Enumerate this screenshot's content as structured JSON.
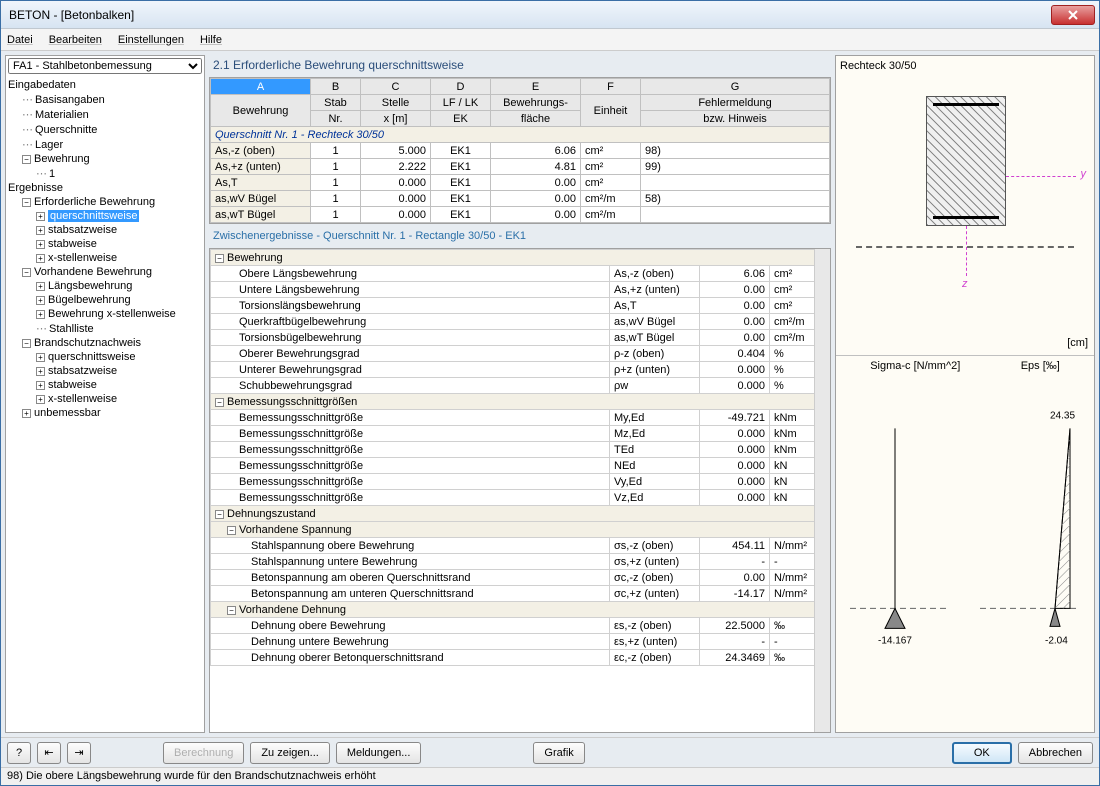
{
  "window": {
    "title": "BETON - [Betonbalken]"
  },
  "menu": {
    "datei": "Datei",
    "bearbeiten": "Bearbeiten",
    "einstellungen": "Einstellungen",
    "hilfe": "Hilfe"
  },
  "sidebar": {
    "selector": "FA1 - Stahlbetonbemessung",
    "nodes": {
      "eingabedaten": "Eingabedaten",
      "basisangaben": "Basisangaben",
      "materialien": "Materialien",
      "querschnitte": "Querschnitte",
      "lager": "Lager",
      "bewehrung": "Bewehrung",
      "bewehrung_1": "1",
      "ergebnisse": "Ergebnisse",
      "erforderliche": "Erforderliche Bewehrung",
      "querschnittsweise": "querschnittsweise",
      "stabsatzweise": "stabsatzweise",
      "stabweise": "stabweise",
      "xstellenweise": "x-stellenweise",
      "vorhandene": "Vorhandene Bewehrung",
      "langsbewehrung": "Längsbewehrung",
      "bugelbewehrung": "Bügelbewehrung",
      "bewehrung_x": "Bewehrung x-stellenweise",
      "stahlliste": "Stahlliste",
      "brandschutz": "Brandschutznachweis",
      "bs_querschnittsweise": "querschnittsweise",
      "bs_stabsatzweise": "stabsatzweise",
      "bs_stabweise": "stabweise",
      "bs_xstellenweise": "x-stellenweise",
      "unbemessbar": "unbemessbar"
    }
  },
  "main": {
    "title": "2.1 Erforderliche Bewehrung querschnittsweise",
    "cols": {
      "A": "A",
      "B": "B",
      "C": "C",
      "D": "D",
      "E": "E",
      "F": "F",
      "G": "G"
    },
    "headers": {
      "bewehrung": "Bewehrung",
      "stab_nr": "Stab\nNr.",
      "stelle": "Stelle\nx [m]",
      "lflk": "LF / LK\nEK",
      "bflache": "Bewehrungs-\nfläche",
      "einheit": "Einheit",
      "fehler": "Fehlermeldung\nbzw. Hinweis"
    },
    "section_row": "Querschnitt Nr. 1 - Rechteck 30/50",
    "rows": [
      {
        "label": "As,-z (oben)",
        "nr": "1",
        "x": "5.000",
        "ek": "EK1",
        "area": "6.06",
        "unit": "cm²",
        "note": "98)"
      },
      {
        "label": "As,+z (unten)",
        "nr": "1",
        "x": "2.222",
        "ek": "EK1",
        "area": "4.81",
        "unit": "cm²",
        "note": "99)"
      },
      {
        "label": "As,T",
        "nr": "1",
        "x": "0.000",
        "ek": "EK1",
        "area": "0.00",
        "unit": "cm²",
        "note": ""
      },
      {
        "label": "as,wV Bügel",
        "nr": "1",
        "x": "0.000",
        "ek": "EK1",
        "area": "0.00",
        "unit": "cm²/m",
        "note": "58)"
      },
      {
        "label": "as,wT Bügel",
        "nr": "1",
        "x": "0.000",
        "ek": "EK1",
        "area": "0.00",
        "unit": "cm²/m",
        "note": ""
      }
    ],
    "sub_title": "Zwischenergebnisse  -  Querschnitt Nr. 1 - Rectangle 30/50  -  EK1",
    "details": {
      "g_bewehrung": "Bewehrung",
      "obere_langs": {
        "label": "Obere Längsbewehrung",
        "sym": "As,-z (oben)",
        "val": "6.06",
        "unit": "cm²"
      },
      "untere_langs": {
        "label": "Untere Längsbewehrung",
        "sym": "As,+z (unten)",
        "val": "0.00",
        "unit": "cm²"
      },
      "torsions_langs": {
        "label": "Torsionslängsbewehrung",
        "sym": "As,T",
        "val": "0.00",
        "unit": "cm²"
      },
      "querkraft": {
        "label": "Querkraftbügelbewehrung",
        "sym": "as,wV Bügel",
        "val": "0.00",
        "unit": "cm²/m"
      },
      "torsions_bugel": {
        "label": "Torsionsbügelbewehrung",
        "sym": "as,wT Bügel",
        "val": "0.00",
        "unit": "cm²/m"
      },
      "oberer_grad": {
        "label": "Oberer Bewehrungsgrad",
        "sym": "ρ-z (oben)",
        "val": "0.404",
        "unit": "%"
      },
      "unterer_grad": {
        "label": "Unterer Bewehrungsgrad",
        "sym": "ρ+z (unten)",
        "val": "0.000",
        "unit": "%"
      },
      "schub_grad": {
        "label": "Schubbewehrungsgrad",
        "sym": "ρw",
        "val": "0.000",
        "unit": "%"
      },
      "g_bemessung": "Bemessungsschnittgrößen",
      "myed": {
        "label": "Bemessungsschnittgröße",
        "sym": "My,Ed",
        "val": "-49.721",
        "unit": "kNm"
      },
      "mzed": {
        "label": "Bemessungsschnittgröße",
        "sym": "Mz,Ed",
        "val": "0.000",
        "unit": "kNm"
      },
      "ted": {
        "label": "Bemessungsschnittgröße",
        "sym": "TEd",
        "val": "0.000",
        "unit": "kNm"
      },
      "ned": {
        "label": "Bemessungsschnittgröße",
        "sym": "NEd",
        "val": "0.000",
        "unit": "kN"
      },
      "vyed": {
        "label": "Bemessungsschnittgröße",
        "sym": "Vy,Ed",
        "val": "0.000",
        "unit": "kN"
      },
      "vzed": {
        "label": "Bemessungsschnittgröße",
        "sym": "Vz,Ed",
        "val": "0.000",
        "unit": "kN"
      },
      "g_dehnung": "Dehnungszustand",
      "g_spannung": "Vorhandene Spannung",
      "sigma_so": {
        "label": "Stahlspannung obere Bewehrung",
        "sym": "σs,-z (oben)",
        "val": "454.11",
        "unit": "N/mm²"
      },
      "sigma_su": {
        "label": "Stahlspannung untere Bewehrung",
        "sym": "σs,+z (unten)",
        "val": "-",
        "unit": "-"
      },
      "sigma_co": {
        "label": "Betonspannung am oberen Querschnittsrand",
        "sym": "σc,-z (oben)",
        "val": "0.00",
        "unit": "N/mm²"
      },
      "sigma_cu": {
        "label": "Betonspannung am unteren Querschnittsrand",
        "sym": "σc,+z (unten)",
        "val": "-14.17",
        "unit": "N/mm²"
      },
      "g_vdehnung": "Vorhandene Dehnung",
      "eps_so": {
        "label": "Dehnung obere Bewehrung",
        "sym": "εs,-z (oben)",
        "val": "22.5000",
        "unit": "‰"
      },
      "eps_su": {
        "label": "Dehnung untere Bewehrung",
        "sym": "εs,+z (unten)",
        "val": "-",
        "unit": "-"
      },
      "eps_co": {
        "label": "Dehnung oberer Betonquerschnittsrand",
        "sym": "εc,-z (oben)",
        "val": "24.3469",
        "unit": "‰"
      }
    }
  },
  "right": {
    "cs_title": "Rechteck 30/50",
    "cm": "[cm]",
    "sigma_label": "Sigma-c [N/mm^2]",
    "eps_label": "Eps [‰]",
    "sigma_val": "-14.167",
    "eps_top": "24.35",
    "eps_bot": "-2.04"
  },
  "bottom": {
    "berechnung": "Berechnung",
    "zuzeigen": "Zu zeigen...",
    "meldungen": "Meldungen...",
    "grafik": "Grafik",
    "ok": "OK",
    "abbrechen": "Abbrechen"
  },
  "status": "98) Die obere Längsbewehrung wurde für den Brandschutznachweis erhöht"
}
